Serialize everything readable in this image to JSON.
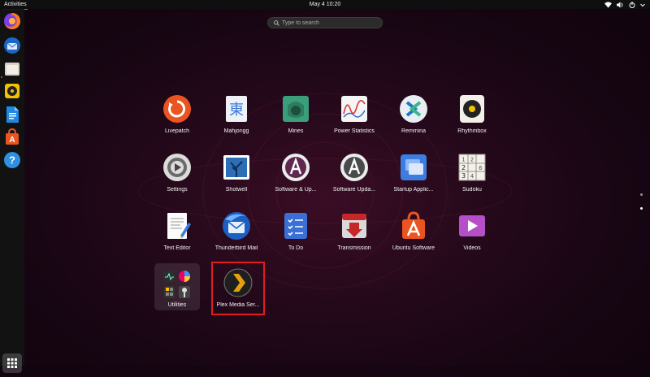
{
  "topbar": {
    "activities": "Activities",
    "clock": "May 4  10:20"
  },
  "search": {
    "placeholder": "Type to search"
  },
  "apps": [
    {
      "label": "Livepatch"
    },
    {
      "label": "Mahjongg"
    },
    {
      "label": "Mines"
    },
    {
      "label": "Power Statistics"
    },
    {
      "label": "Remmina"
    },
    {
      "label": "Rhythmbox"
    },
    {
      "label": "Settings"
    },
    {
      "label": "Shotwell"
    },
    {
      "label": "Software & Up..."
    },
    {
      "label": "Software Upda..."
    },
    {
      "label": "Startup Applic..."
    },
    {
      "label": "Sudoku"
    },
    {
      "label": "Text Editor"
    },
    {
      "label": "Thunderbird Mail"
    },
    {
      "label": "To Do"
    },
    {
      "label": "Transmission"
    },
    {
      "label": "Ubuntu Software"
    },
    {
      "label": "Videos"
    },
    {
      "label": "Utilities"
    },
    {
      "label": "Plex Media Ser..."
    }
  ],
  "icons": {
    "mahjongg_glyph": "東",
    "sudoku_digits": [
      "1",
      "2",
      "2",
      "3",
      "4",
      "6"
    ]
  },
  "colors": {
    "accent": "#e95420",
    "highlight": "#e11d1d"
  }
}
